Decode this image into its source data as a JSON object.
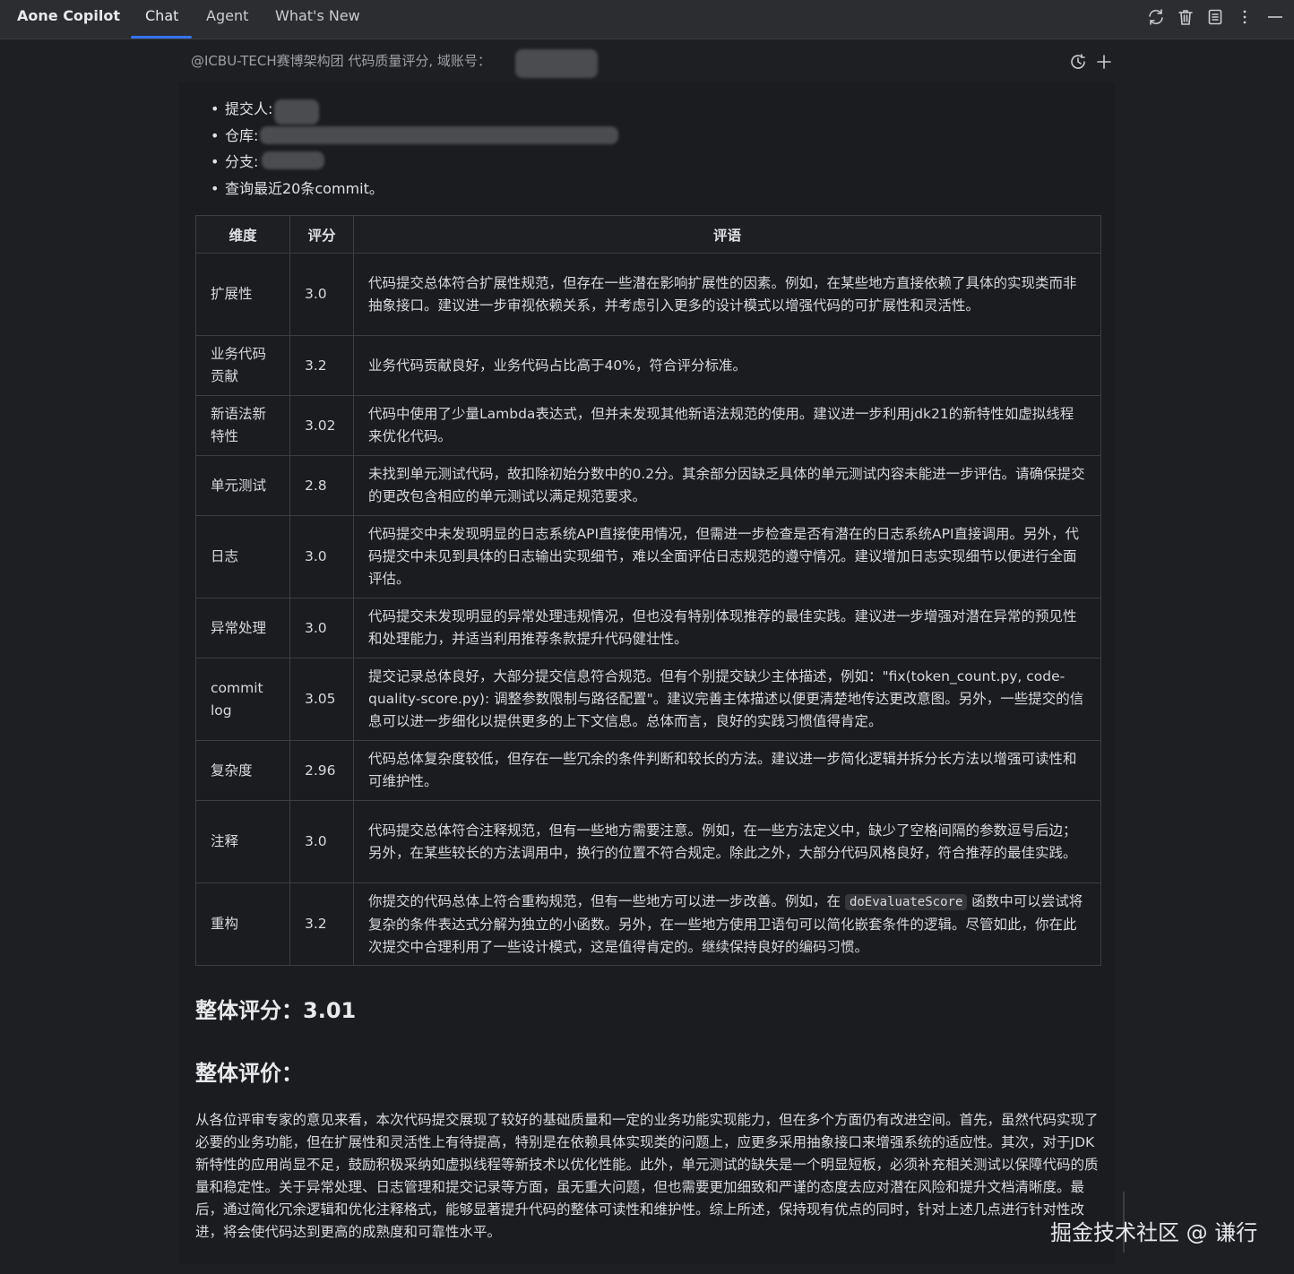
{
  "header": {
    "brand": "Aone Copilot",
    "tabs": [
      {
        "label": "Chat",
        "active": true
      },
      {
        "label": "Agent",
        "active": false
      },
      {
        "label": "What's New",
        "active": false
      }
    ],
    "icons": [
      "refresh-icon",
      "trash-icon",
      "document-icon",
      "more-vertical-icon",
      "minimize-icon"
    ]
  },
  "subheader": {
    "prompt": "@ICBU-TECH赛博架构团 代码质量评分, 域账号：",
    "icons": [
      "history-icon",
      "plus-icon"
    ]
  },
  "bullets": [
    {
      "label": "提交人:"
    },
    {
      "label": "仓库:"
    },
    {
      "label": "分支:"
    },
    {
      "label": "查询最近20条commit。"
    }
  ],
  "table": {
    "headers": [
      "维度",
      "评分",
      "评语"
    ],
    "rows": [
      {
        "dimension": "扩展性",
        "score": "3.0",
        "comment": "代码提交总体符合扩展性规范，但存在一些潜在影响扩展性的因素。例如，在某些地方直接依赖了具体的实现类而非抽象接口。建议进一步审视依赖关系，并考虑引入更多的设计模式以增强代码的可扩展性和灵活性。"
      },
      {
        "dimension": "业务代码贡献",
        "score": "3.2",
        "comment": "业务代码贡献良好，业务代码占比高于40%，符合评分标准。"
      },
      {
        "dimension": "新语法新特性",
        "score": "3.02",
        "comment": "代码中使用了少量Lambda表达式，但并未发现其他新语法规范的使用。建议进一步利用jdk21的新特性如虚拟线程来优化代码。"
      },
      {
        "dimension": "单元测试",
        "score": "2.8",
        "comment": "未找到单元测试代码，故扣除初始分数中的0.2分。其余部分因缺乏具体的单元测试内容未能进一步评估。请确保提交的更改包含相应的单元测试以满足规范要求。"
      },
      {
        "dimension": "日志",
        "score": "3.0",
        "comment": "代码提交中未发现明显的日志系统API直接使用情况，但需进一步检查是否有潜在的日志系统API直接调用。另外，代码提交中未见到具体的日志输出实现细节，难以全面评估日志规范的遵守情况。建议增加日志实现细节以便进行全面评估。"
      },
      {
        "dimension": "异常处理",
        "score": "3.0",
        "comment": "代码提交未发现明显的异常处理违规情况，但也没有特别体现推荐的最佳实践。建议进一步增强对潜在异常的预见性和处理能力，并适当利用推荐条款提升代码健壮性。"
      },
      {
        "dimension": "commit log",
        "score": "3.05",
        "comment": "提交记录总体良好，大部分提交信息符合规范。但有个别提交缺少主体描述，例如：\"fix(token_count.py, code-quality-score.py): 调整参数限制与路径配置\"。建议完善主体描述以便更清楚地传达更改意图。另外，一些提交的信息可以进一步细化以提供更多的上下文信息。总体而言，良好的实践习惯值得肯定。"
      },
      {
        "dimension": "复杂度",
        "score": "2.96",
        "comment": "代码总体复杂度较低，但存在一些冗余的条件判断和较长的方法。建议进一步简化逻辑并拆分长方法以增强可读性和可维护性。"
      },
      {
        "dimension": "注释",
        "score": "3.0",
        "comment": "代码提交总体符合注释规范，但有一些地方需要注意。例如，在一些方法定义中，缺少了空格间隔的参数逗号后边；另外，在某些较长的方法调用中，换行的位置不符合规定。除此之外，大部分代码风格良好，符合推荐的最佳实践。"
      },
      {
        "dimension": "重构",
        "score": "3.2",
        "comment_before": "你提交的代码总体上符合重构规范，但有一些地方可以进一步改善。例如，在 ",
        "comment_code": "doEvaluateScore",
        "comment_after": " 函数中可以尝试将复杂的条件表达式分解为独立的小函数。另外，在一些地方使用卫语句可以简化嵌套条件的逻辑。尽管如此，你在此次提交中合理利用了一些设计模式，这是值得肯定的。继续保持良好的编码习惯。"
      }
    ]
  },
  "overall": {
    "score_heading": "整体评分：3.01",
    "eval_heading": "整体评价：",
    "summary": "从各位评审专家的意见来看，本次代码提交展现了较好的基础质量和一定的业务功能实现能力，但在多个方面仍有改进空间。首先，虽然代码实现了必要的业务功能，但在扩展性和灵活性上有待提高，特别是在依赖具体实现类的问题上，应更多采用抽象接口来增强系统的适应性。其次，对于JDK新特性的应用尚显不足，鼓励积极采纳如虚拟线程等新技术以优化性能。此外，单元测试的缺失是一个明显短板，必须补充相关测试以保障代码的质量和稳定性。关于异常处理、日志管理和提交记录等方面，虽无重大问题，但也需要更加细致和严谨的态度去应对潜在风险和提升文档清晰度。最后，通过简化冗余逻辑和优化注释格式，能够显著提升代码的整体可读性和维护性。综上所述，保持现有优点的同时，针对上述几点进行针对性改进，将会使代码达到更高的成熟度和可靠性水平。"
  },
  "watermark": "掘金技术社区 @ 谦行",
  "colors": {
    "background": "#1e1f22",
    "topbar": "#2b2d30",
    "accent": "#3574f0",
    "border": "#3c3e42"
  }
}
